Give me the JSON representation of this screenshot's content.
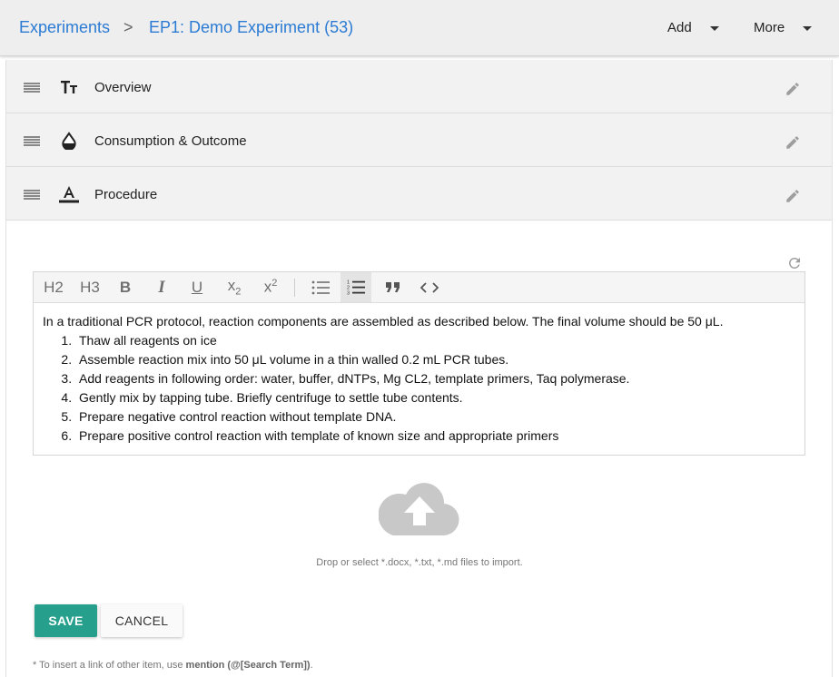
{
  "breadcrumb": {
    "root": "Experiments",
    "separator": ">",
    "current": "EP1: Demo Experiment (53)"
  },
  "menus": {
    "add_label": "Add",
    "more_label": "More"
  },
  "sections": [
    {
      "title": "Overview",
      "icon": "text-size-icon"
    },
    {
      "title": "Consumption & Outcome",
      "icon": "drop-icon"
    },
    {
      "title": "Procedure",
      "icon": "text-color-icon"
    }
  ],
  "toolbar": {
    "h2": "H2",
    "h3": "H3",
    "bold": "B",
    "italic": "I",
    "underline": "U",
    "subscript_base": "x",
    "subscript_mark": "2",
    "superscript_base": "x",
    "superscript_mark": "2",
    "active_button": "ordered-list"
  },
  "editor": {
    "intro": "In a traditional PCR protocol, reaction components are assembled as described below. The final volume should be 50 μL.",
    "steps": [
      "Thaw all reagents on ice",
      "Assemble reaction mix into 50 μL volume in a thin walled 0.2 mL PCR tubes.",
      "Add reagents in following order: water, buffer, dNTPs, Mg CL2, template primers, Taq polymerase.",
      "Gently mix by tapping tube. Briefly centrifuge to settle tube contents.",
      "Prepare negative control reaction without template DNA.",
      "Prepare positive control reaction with template of known size and appropriate primers"
    ]
  },
  "upload": {
    "text": "Drop or select *.docx, *.txt, *.md files to import."
  },
  "actions": {
    "save_label": "SAVE",
    "cancel_label": "CANCEL"
  },
  "footnote": {
    "prefix": "* To insert a link of other item, use ",
    "emphasis": "mention (@[Search Term])",
    "suffix": "."
  },
  "colors": {
    "link": "#2b7bd4",
    "save_button": "#26a08c",
    "header_bg": "#eeeeee",
    "section_bg": "#f2f2f2"
  }
}
